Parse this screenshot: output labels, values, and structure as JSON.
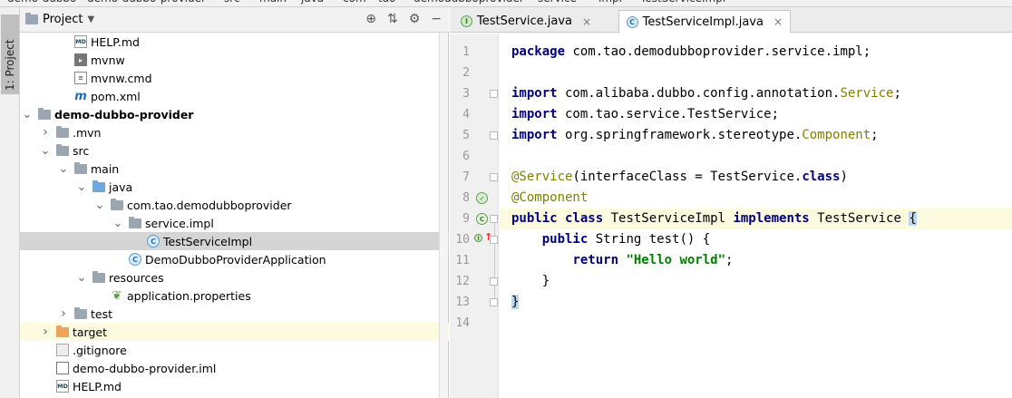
{
  "breadcrumbs": [
    "demo-dubbo",
    "demo-dubbo-provider",
    "src",
    "main",
    "java",
    "com",
    "tao",
    "demodubboprovider",
    "service",
    "impl",
    "TestServiceImpl"
  ],
  "toolstrip": {
    "tab_label": "1: Project"
  },
  "project_panel": {
    "title": "Project",
    "tools": {
      "locate_icon": "target-icon",
      "collapse_icon": "collapse-icon",
      "settings_icon": "gear-icon",
      "hide_icon": "hide-icon"
    },
    "tree": [
      {
        "label": "HELP.md",
        "icon": "md",
        "level": 3
      },
      {
        "label": "mvnw",
        "icon": "sh",
        "level": 3
      },
      {
        "label": "mvnw.cmd",
        "icon": "cmd",
        "level": 3
      },
      {
        "label": "pom.xml",
        "icon": "mvn",
        "level": 3
      },
      {
        "label": "demo-dubbo-provider",
        "icon": "module",
        "level": 1,
        "arrow": "down",
        "bold": true
      },
      {
        "label": ".mvn",
        "icon": "folder",
        "level": 2,
        "arrow": "right"
      },
      {
        "label": "src",
        "icon": "folder",
        "level": 2,
        "arrow": "down"
      },
      {
        "label": "main",
        "icon": "folder",
        "level": 3,
        "arrow": "down"
      },
      {
        "label": "java",
        "icon": "folder-blue",
        "level": 4,
        "arrow": "down"
      },
      {
        "label": "com.tao.demodubboprovider",
        "icon": "package",
        "level": 5,
        "arrow": "down"
      },
      {
        "label": "service.impl",
        "icon": "package",
        "level": 6,
        "arrow": "down"
      },
      {
        "label": "TestServiceImpl",
        "icon": "class",
        "level": 7,
        "selected": true
      },
      {
        "label": "DemoDubboProviderApplication",
        "icon": "app",
        "level": 6
      },
      {
        "label": "resources",
        "icon": "folder-res",
        "level": 4,
        "arrow": "down"
      },
      {
        "label": "application.properties",
        "icon": "prop",
        "level": 5
      },
      {
        "label": "test",
        "icon": "folder",
        "level": 3,
        "arrow": "right"
      },
      {
        "label": "target",
        "icon": "folder-orange",
        "level": 2,
        "arrow": "right",
        "highlight": true
      },
      {
        "label": ".gitignore",
        "icon": "git",
        "level": 2
      },
      {
        "label": "demo-dubbo-provider.iml",
        "icon": "iml",
        "level": 2
      },
      {
        "label": "HELP.md",
        "icon": "md",
        "level": 2
      }
    ]
  },
  "editor": {
    "tabs": [
      {
        "label": "TestService.java",
        "icon": "I",
        "active": false
      },
      {
        "label": "TestServiceImpl.java",
        "icon": "C",
        "active": true
      }
    ],
    "lines": [
      {
        "n": "1",
        "html": "<span class=\"kw\">package</span> com.tao.demodubboprovider.service.impl;"
      },
      {
        "n": "2",
        "html": ""
      },
      {
        "n": "3",
        "html": "<span class=\"kw\">import</span> com.alibaba.dubbo.config.annotation.<span class=\"ann\">Service</span>;"
      },
      {
        "n": "4",
        "html": "<span class=\"kw\">import</span> com.tao.service.TestService;"
      },
      {
        "n": "5",
        "html": "<span class=\"kw\">import</span> org.springframework.stereotype.<span class=\"ann\">Component</span>;"
      },
      {
        "n": "6",
        "html": ""
      },
      {
        "n": "7",
        "html": "<span class=\"ann\">@Service</span>(interfaceClass = TestService.<span class=\"kw\">class</span>)"
      },
      {
        "n": "8",
        "html": "<span class=\"ann\">@Component</span>"
      },
      {
        "n": "9",
        "html": "<span class=\"kw\">public class</span> TestServiceImpl <span class=\"kw\">implements</span> TestService <span class=\"brace-hl\">{</span>"
      },
      {
        "n": "10",
        "html": "    <span class=\"kw\">public</span> String test() {"
      },
      {
        "n": "11",
        "html": "        <span class=\"kw\">return</span> <span class=\"str\">\"Hello world\"</span>;"
      },
      {
        "n": "12",
        "html": "    }"
      },
      {
        "n": "13",
        "html": "<span class=\"brace-hl\">}</span>"
      },
      {
        "n": "14",
        "html": ""
      }
    ]
  }
}
